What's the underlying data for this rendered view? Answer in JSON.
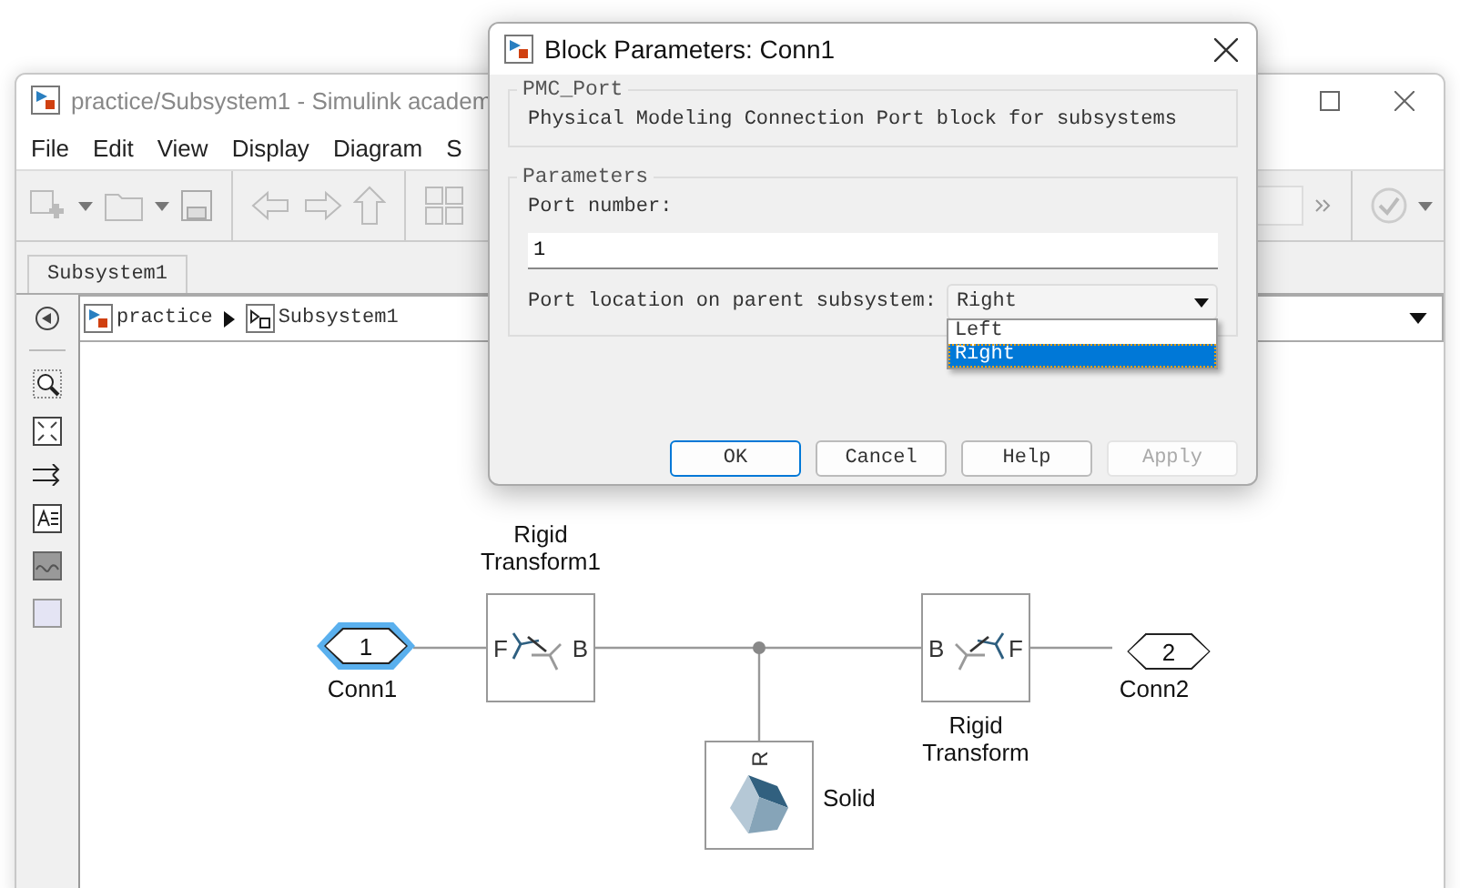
{
  "simulink_window": {
    "title": "practice/Subsystem1 - Simulink academ",
    "menu": [
      "File",
      "Edit",
      "View",
      "Display",
      "Diagram",
      "S"
    ],
    "tabs": [
      {
        "label": "Subsystem1",
        "selected": true
      }
    ],
    "breadcrumb": [
      "practice",
      "Subsystem1"
    ],
    "diagram": {
      "blocks": [
        {
          "kind": "port",
          "number": "1",
          "label": "Conn1",
          "selected": true
        },
        {
          "kind": "transform",
          "label": "Rigid Transform1",
          "left_port": "F",
          "right_port": "B",
          "selected": false
        },
        {
          "kind": "solid",
          "label": "Solid",
          "top_port": "R",
          "selected": false
        },
        {
          "kind": "transform",
          "label": "Rigid Transform",
          "left_port": "B",
          "right_port": "F",
          "selected": false
        },
        {
          "kind": "port",
          "number": "2",
          "label": "Conn2",
          "selected": false
        }
      ]
    }
  },
  "dialog": {
    "title": "Block Parameters: Conn1",
    "block_group": {
      "title": "PMC_Port",
      "description": "Physical Modeling Connection Port block for subsystems"
    },
    "parameters": {
      "title": "Parameters",
      "port_number": {
        "label": "Port number:",
        "value": "1"
      },
      "port_location": {
        "label": "Port location on parent subsystem:",
        "value": "Right",
        "expanded": true,
        "options": [
          {
            "label": "Left",
            "selected": false
          },
          {
            "label": "Right",
            "selected": true
          }
        ]
      }
    },
    "buttons": [
      {
        "label": "OK",
        "default": true,
        "disabled": false
      },
      {
        "label": "Cancel",
        "default": false,
        "disabled": false
      },
      {
        "label": "Help",
        "default": false,
        "disabled": false
      },
      {
        "label": "Apply",
        "default": false,
        "disabled": true
      }
    ]
  }
}
